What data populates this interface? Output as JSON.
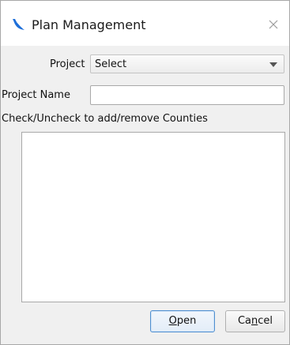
{
  "window": {
    "title": "Plan Management",
    "app_icon": "blue-brush-logo",
    "close_icon": "close-icon"
  },
  "form": {
    "project_label": "Project",
    "project_select_value": "Select",
    "project_name_label": "Project Name",
    "project_name_value": "",
    "counties_instruction": "Check/Uncheck to add/remove Counties",
    "counties": []
  },
  "buttons": {
    "open": {
      "mnemonic": "O",
      "rest": "pen"
    },
    "cancel": {
      "before": "Ca",
      "mnemonic": "n",
      "rest": "cel"
    }
  },
  "colors": {
    "default_button_border": "#4f8fd0",
    "logo_blue": "#1e6fd9"
  }
}
